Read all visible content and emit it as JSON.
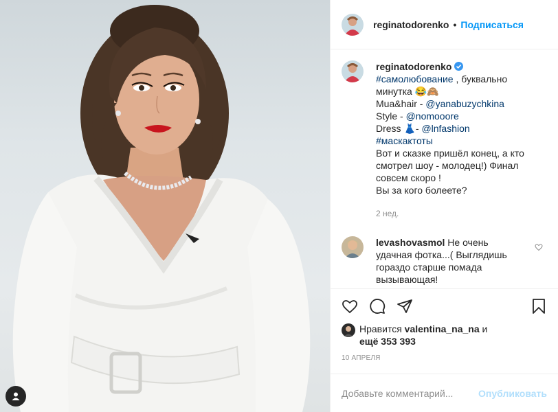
{
  "post": {
    "author": "reginatodorenko",
    "follow_label": "Подписаться",
    "dot": "•"
  },
  "caption": {
    "author": "reginatodorenko",
    "line1_tag": "#самолюбование",
    "line1_rest": " , буквально",
    "line2": "минутка 😂🙈",
    "line3_prefix": "Mua&hair - ",
    "line3_mention": "@yanabuzychkina",
    "line4_prefix": "Style - ",
    "line4_mention": "@nomooore",
    "line5_prefix": "Dress 👗- ",
    "line5_mention": "@lnfashion",
    "line6_tag": "#маскактоты",
    "line7": "Вот и сказке пришёл конец, а кто",
    "line8": "смотрел шоу - молодец!) Финал",
    "line9": "совсем скоро !",
    "line10": "Вы за кого болеете?",
    "time": "2 нед."
  },
  "comment": {
    "author": "levashovasmol",
    "text1": " Не очень",
    "text2": "удачная фотка...( Выглядишь",
    "text3": "гораздо старше помада",
    "text4": "вызывающая!"
  },
  "likes": {
    "prefix": "Нравится ",
    "user": "valentina_na_na",
    "middle": " и",
    "line2_prefix": "ещё ",
    "count": "353 393"
  },
  "date": "10 АПРЕЛЯ",
  "add_comment": {
    "placeholder": "Добавьте комментарий...",
    "post_label": "Опубликовать"
  },
  "icons": {
    "like": "heart-icon",
    "comment": "comment-icon",
    "share": "paper-plane-icon",
    "save": "bookmark-icon",
    "tag": "user-tag-icon",
    "verified": "verified-badge-icon"
  },
  "colors": {
    "accent": "#0095f6",
    "link": "#00376b",
    "muted": "#8e8e8e",
    "post_disabled": "#b2dffc",
    "lips": "#c8141d"
  }
}
